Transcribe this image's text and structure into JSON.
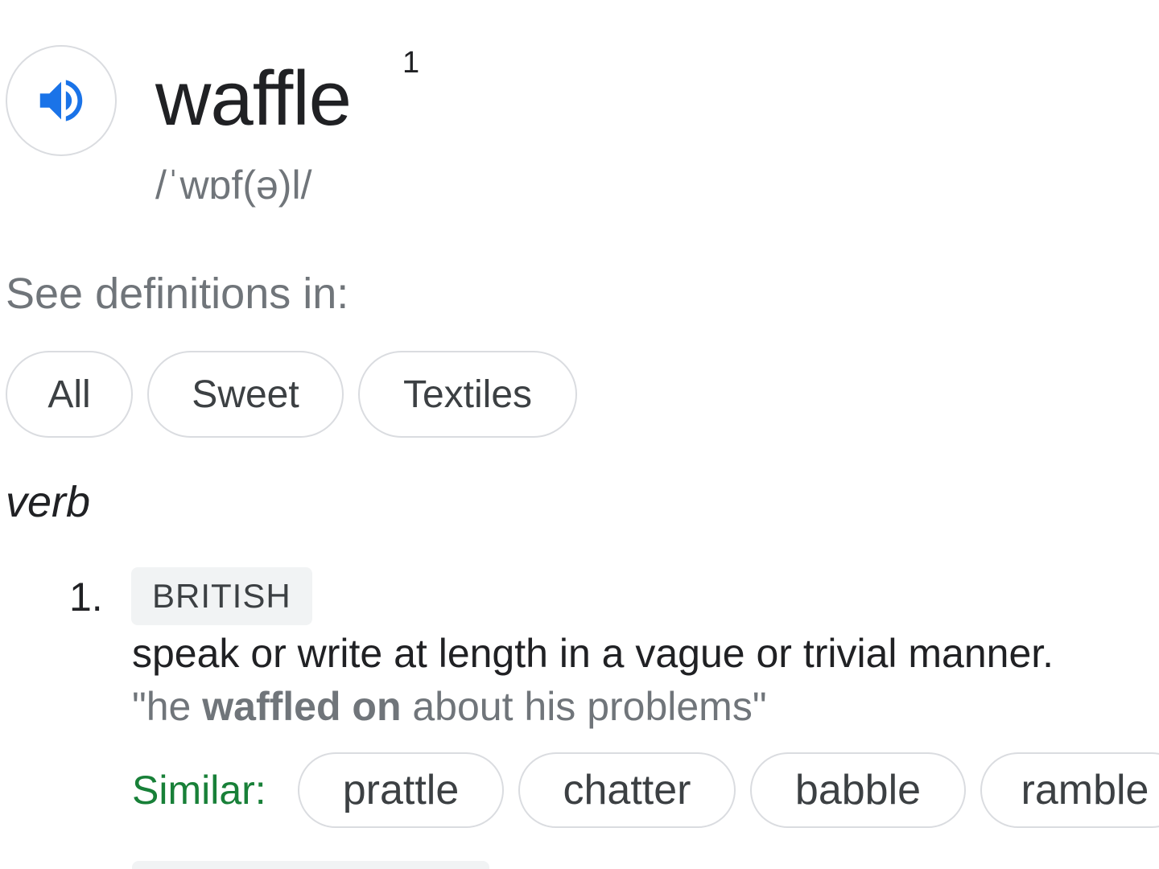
{
  "entry": {
    "word": "waffle",
    "superscript": "1",
    "phonetic": "/ˈwɒf(ə)l/",
    "audio_icon": "speaker-volume-icon",
    "accent_color": "#1a73e8"
  },
  "see_definitions": {
    "label": "See definitions in:",
    "chips": [
      "All",
      "Sweet",
      "Textiles"
    ]
  },
  "part_of_speech": "verb",
  "senses": [
    {
      "number": "1.",
      "label": "BRITISH",
      "definition": "speak or write at length in a vague or trivial manner.",
      "example_open": "\"he ",
      "example_bold": "waffled on",
      "example_close": " about his problems\"",
      "similar_label": "Similar:",
      "similar_color": "#188038",
      "similar": [
        "prattle",
        "chatter",
        "babble",
        "ramble"
      ]
    }
  ]
}
